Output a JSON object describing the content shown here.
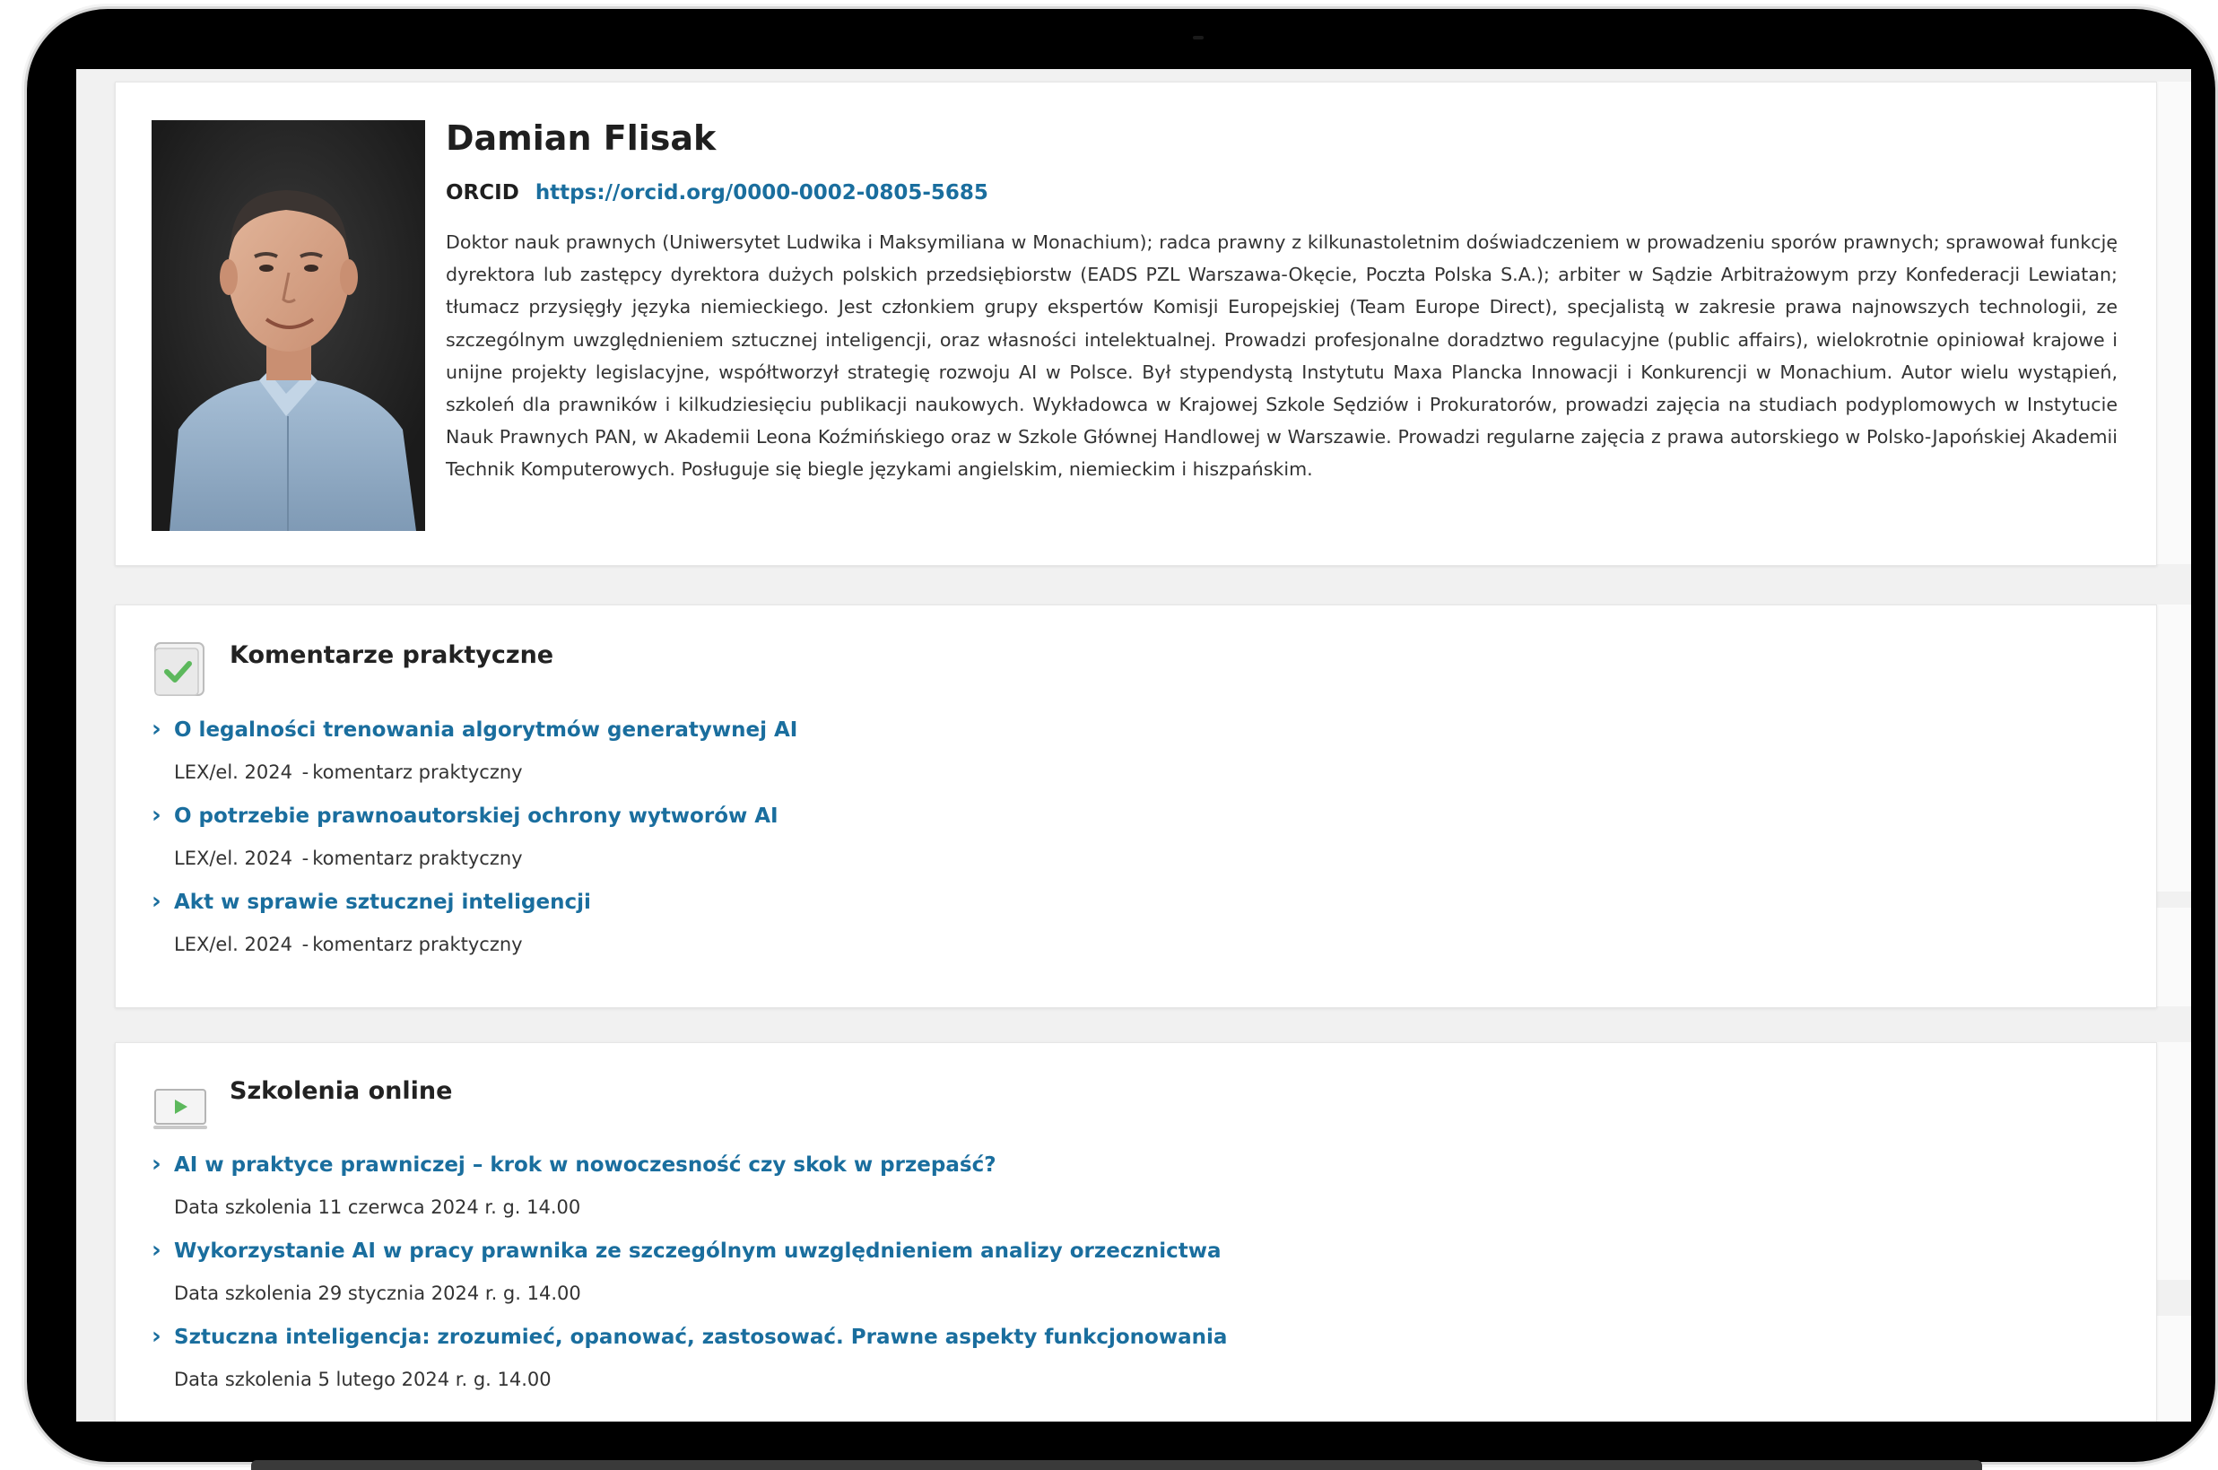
{
  "profile": {
    "name": "Damian Flisak",
    "orcid_label": "ORCID",
    "orcid_url": "https://orcid.org/0000-0002-0805-5685",
    "bio": "Doktor nauk prawnych (Uniwersytet Ludwika i Maksymiliana w Monachium); radca prawny z kilkunastoletnim doświadczeniem w prowadzeniu sporów prawnych; sprawował funkcję dyrektora lub zastępcy dyrektora dużych polskich przedsiębiorstw (EADS PZL Warszawa-Okęcie, Poczta Polska S.A.); arbiter w Sądzie Arbitrażowym przy Konfederacji Lewiatan; tłumacz przysięgły języka niemieckiego. Jest członkiem grupy ekspertów Komisji Europejskiej (Team Europe Direct), specjalistą w zakresie prawa najnowszych technologii, ze szczególnym uwzględnieniem sztucznej inteligencji, oraz własności intelektualnej. Prowadzi profesjonalne doradztwo regulacyjne (public affairs), wielokrotnie opiniował krajowe i unijne projekty legislacyjne, współtworzył strategię rozwoju AI w Polsce. Był stypendystą Instytutu Maxa Plancka Innowacji i Konkurencji w Monachium. Autor wielu wystąpień, szkoleń dla prawników i kilkudziesięciu publikacji naukowych. Wykładowca w Krajowej Szkole Sędziów i Prokuratorów, prowadzi zajęcia na studiach podyplomowych w Instytucie Nauk Prawnych PAN, w Akademii Leona Koźmińskiego oraz w Szkole Głównej Handlowej w Warszawie. Prowadzi regularne zajęcia z prawa autorskiego w Polsko-Japońskiej Akademii Technik Komputerowych. Posługuje się biegle językami angielskim, niemieckim i hiszpańskim."
  },
  "comments": {
    "title": "Komentarze praktyczne",
    "icon": "check-icon",
    "items": [
      {
        "title": "O legalności trenowania algorytmów generatywnej AI",
        "source": "LEX/el. 2024",
        "sep": "-",
        "type": "komentarz praktyczny"
      },
      {
        "title": "O potrzebie prawnoautorskiej ochrony wytworów AI",
        "source": "LEX/el. 2024",
        "sep": "-",
        "type": "komentarz praktyczny"
      },
      {
        "title": "Akt w sprawie sztucznej inteligencji",
        "source": "LEX/el. 2024",
        "sep": "-",
        "type": "komentarz praktyczny"
      }
    ]
  },
  "trainings": {
    "title": "Szkolenia online",
    "icon": "play-video-icon",
    "items": [
      {
        "title": "AI w praktyce prawniczej – krok w nowoczesność czy skok w przepaść?",
        "date": "Data szkolenia 11 czerwca 2024 r. g. 14.00"
      },
      {
        "title": "Wykorzystanie AI w pracy prawnika ze szczególnym uwzględnieniem analizy orzecznictwa",
        "date": "Data szkolenia 29 stycznia 2024 r. g. 14.00"
      },
      {
        "title": "Sztuczna inteligencja: zrozumieć, opanować, zastosować. Prawne aspekty funkcjonowania",
        "date": "Data szkolenia 5 lutego 2024 r. g. 14.00"
      }
    ]
  },
  "colors": {
    "link": "#1a6e9e",
    "check_green": "#5cb85c",
    "frame": "#000000",
    "page_bg": "#f1f1f1"
  }
}
